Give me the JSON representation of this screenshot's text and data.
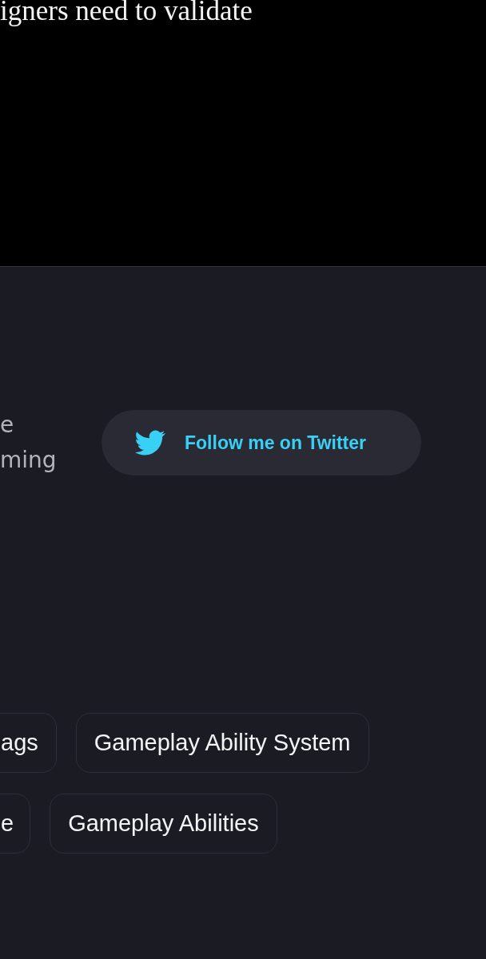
{
  "hero": {
    "text": "igners need to validate"
  },
  "intro": {
    "lines": [
      "e",
      "ming"
    ]
  },
  "follow_button": {
    "label": "Follow me on Twitter"
  },
  "tag_rows": [
    [
      "ags",
      "Gameplay Ability System"
    ],
    [
      "e",
      "Gameplay Abilities"
    ]
  ]
}
